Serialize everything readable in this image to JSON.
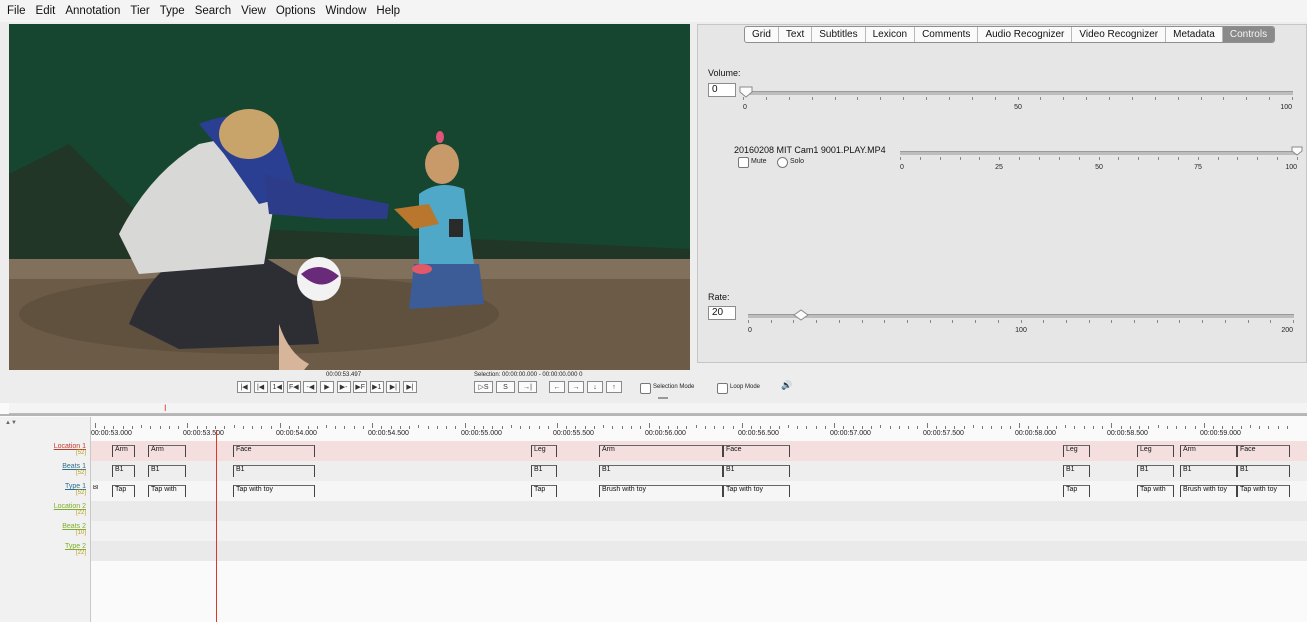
{
  "menu": [
    "File",
    "Edit",
    "Annotation",
    "Tier",
    "Type",
    "Search",
    "View",
    "Options",
    "Window",
    "Help"
  ],
  "tabs": [
    {
      "label": "Grid",
      "active": false
    },
    {
      "label": "Text",
      "active": false
    },
    {
      "label": "Subtitles",
      "active": false
    },
    {
      "label": "Lexicon",
      "active": false
    },
    {
      "label": "Comments",
      "active": false
    },
    {
      "label": "Audio Recognizer",
      "active": false
    },
    {
      "label": "Video Recognizer",
      "active": false
    },
    {
      "label": "Metadata",
      "active": false
    },
    {
      "label": "Controls",
      "active": true
    }
  ],
  "controls": {
    "volume_label": "Volume:",
    "volume_value": "0",
    "volume_ticks": [
      "0",
      "50",
      "100"
    ],
    "file_name": "20160208 MIT Cam1 9001.PLAY.MP4",
    "mute_label": "Mute",
    "solo_label": "Solo",
    "file_ticks": [
      "0",
      "25",
      "50",
      "75",
      "100"
    ],
    "rate_label": "Rate:",
    "rate_value": "20",
    "rate_ticks": [
      "0",
      "100",
      "200"
    ]
  },
  "player": {
    "current_time": "00:00:53.497",
    "selection": "Selection: 00:00:00.000 - 00:00:00.000  0",
    "buttons": [
      "|◀",
      "|◀",
      "1◀",
      "F◀",
      "-◀",
      "▶",
      "▶-",
      "▶F",
      "▶1",
      "▶|",
      "▶|"
    ],
    "sel_buttons": [
      "▷S",
      "S",
      "→|",
      "←",
      "→",
      "↓",
      "↑"
    ],
    "selection_mode": "Selection Mode",
    "loop_mode": "Loop Mode",
    "speaker_icon": "speaker-icon"
  },
  "timeline": {
    "ruler": [
      "00:00:53.000",
      "00:00:53.500",
      "00:00:54.000",
      "00:00:54.500",
      "00:00:55.000",
      "00:00:55.500",
      "00:00:56.000",
      "00:00:56.500",
      "00:00:57.000",
      "00:00:57.500",
      "00:00:58.000",
      "00:00:58.500",
      "00:00:59.000"
    ],
    "tiers": [
      {
        "name": "Location 1",
        "count": "[52]",
        "color": "#c0392b"
      },
      {
        "name": "Beats 1",
        "count": "[52]",
        "color": "#2e6f8e"
      },
      {
        "name": "Type 1",
        "count": "[52]",
        "color": "#2e6f8e"
      },
      {
        "name": "Location 2",
        "count": "[22]",
        "color": "#7cae2a"
      },
      {
        "name": "Beats 2",
        "count": "[10]",
        "color": "#7cae2a"
      },
      {
        "name": "Type 2",
        "count": "[22]",
        "color": "#7cae2a"
      }
    ],
    "location1": [
      "Arm",
      "Arm",
      "Face",
      "Leg",
      "Arm",
      "Face",
      "Leg",
      "Leg",
      "Arm",
      "Face"
    ],
    "beats1": [
      "B1",
      "B1",
      "B1",
      "B1",
      "B1",
      "B1",
      "B1",
      "B1",
      "B1",
      "B1"
    ],
    "type1": [
      "Tap",
      "Tap with",
      "Tap with toy",
      "Tap",
      "Brush with toy",
      "Tap with toy",
      "Tap",
      "Tap with",
      "Brush with toy",
      "Tap with toy"
    ],
    "type1_prefix": "Bl"
  },
  "colors": {
    "selection_cursor": "#d9382b",
    "tab_active": "#8a8a8a"
  }
}
